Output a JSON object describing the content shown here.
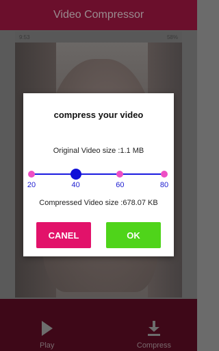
{
  "app": {
    "title": "Video Compressor"
  },
  "status_bar": {
    "time": "9:53",
    "battery": "58%"
  },
  "dialog": {
    "title": "compress your video",
    "original_size_text": "Original Video size :1.1 MB",
    "compressed_size_text": "Compressed Video size :678.07 KB",
    "slider": {
      "value": 40,
      "steps": [
        20,
        40,
        60,
        80
      ],
      "labels": [
        "20",
        "40",
        "60",
        "80"
      ],
      "track_color": "#1a1ae0",
      "dot_color": "#ee4fc4",
      "thumb_color": "#1010d8"
    },
    "cancel_label": "CANEL",
    "ok_label": "OK",
    "cancel_color": "#e2126a",
    "ok_color": "#4fd41a"
  },
  "bottom_bar": {
    "play_label": "Play",
    "compress_label": "Compress",
    "play_icon": "play-icon",
    "compress_icon": "download-icon"
  },
  "colors": {
    "app_bar": "#6b0f2c",
    "bottom_bar": "#3e0818"
  }
}
